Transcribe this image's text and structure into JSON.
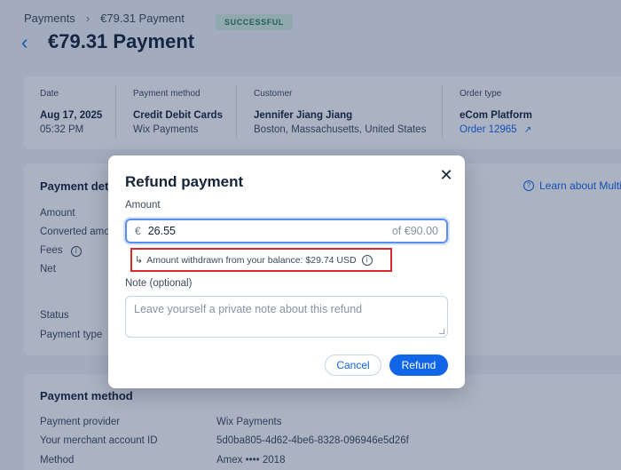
{
  "breadcrumb": {
    "root": "Payments",
    "current": "€79.31 Payment"
  },
  "status_badge": "SUCCESSFUL",
  "page_title": "€79.31 Payment",
  "summary": {
    "date": {
      "label": "Date",
      "value": "Aug 17, 2025",
      "sub": "05:32 PM"
    },
    "payment_method": {
      "label": "Payment method",
      "value": "Credit Debit Cards",
      "sub": "Wix Payments"
    },
    "customer": {
      "label": "Customer",
      "value": "Jennifer Jiang Jiang",
      "sub": "Boston, Massachusetts, United States"
    },
    "order_type": {
      "label": "Order type",
      "value": "eCom Platform",
      "link": "Order 12965"
    }
  },
  "details": {
    "title": "Payment det",
    "learn_link": "Learn about Multi-",
    "rows": [
      "Amount",
      "Converted amo",
      "Fees",
      "Net",
      "Status",
      "Payment type"
    ]
  },
  "method": {
    "title": "Payment method",
    "rows": [
      {
        "label": "Payment provider",
        "value": "Wix Payments"
      },
      {
        "label": "Your merchant account ID",
        "value": "5d0ba805-4d62-4be6-8328-096946e5d26f"
      },
      {
        "label": "Method",
        "value": "Amex •••• 2018"
      }
    ]
  },
  "modal": {
    "title": "Refund payment",
    "amount_label": "Amount",
    "currency_symbol": "€",
    "amount_value": "26.55",
    "amount_of": "of €90.00",
    "balance_hint": "Amount withdrawn from your balance: $29.74 USD",
    "note_label": "Note (optional)",
    "note_placeholder": "Leave yourself a private note about this refund",
    "cancel_label": "Cancel",
    "refund_label": "Refund"
  },
  "colors": {
    "accent": "#1166e8",
    "highlight_border": "#d82a2a",
    "badge_bg": "#d4efe0"
  }
}
